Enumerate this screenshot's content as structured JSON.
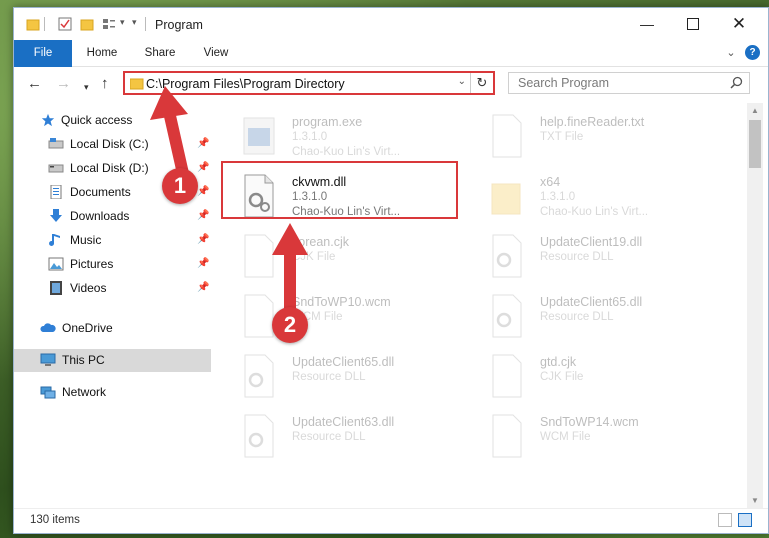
{
  "window": {
    "title": "Program",
    "controls": [
      "minimize",
      "maximize",
      "close"
    ]
  },
  "ribbon": {
    "tabs": [
      "File",
      "Home",
      "Share",
      "View"
    ]
  },
  "nav": {
    "address": "C:\\Program Files\\Program Directory",
    "search_placeholder": "Search Program"
  },
  "sidebar": {
    "items": [
      {
        "label": "Quick access",
        "icon": "star-icon"
      },
      {
        "label": "Local Disk (C:)",
        "icon": "drive-icon",
        "pinned": true
      },
      {
        "label": "Local Disk (D:)",
        "icon": "drive-icon",
        "pinned": true
      },
      {
        "label": "Documents",
        "icon": "documents-icon",
        "pinned": true
      },
      {
        "label": "Downloads",
        "icon": "download-icon",
        "pinned": true
      },
      {
        "label": "Music",
        "icon": "music-icon",
        "pinned": true
      },
      {
        "label": "Pictures",
        "icon": "pictures-icon",
        "pinned": true
      },
      {
        "label": "Videos",
        "icon": "videos-icon",
        "pinned": true
      },
      {
        "label": "OneDrive",
        "icon": "cloud-icon"
      },
      {
        "label": "This PC",
        "icon": "computer-icon",
        "selected": true
      },
      {
        "label": "Network",
        "icon": "network-icon"
      }
    ]
  },
  "files": {
    "left": [
      {
        "name": "program.exe",
        "line2": "1.3.1.0",
        "line3": "Chao-Kuo Lin's Virt...",
        "faded": true,
        "icon": "exe-icon"
      },
      {
        "name": "ckvwm.dll",
        "line2": "1.3.1.0",
        "line3": "Chao-Kuo Lin's Virt...",
        "faded": false,
        "icon": "dll-icon"
      },
      {
        "name": "korean.cjk",
        "line2": "CJK File",
        "faded": true,
        "icon": "file-icon"
      },
      {
        "name": "SndToWP10.wcm",
        "line2": "WCM File",
        "faded": true,
        "icon": "file-icon"
      },
      {
        "name": "UpdateClient65.dll",
        "line2": "Resource DLL",
        "faded": true,
        "icon": "dll-icon"
      },
      {
        "name": "UpdateClient63.dll",
        "line2": "Resource DLL",
        "faded": true,
        "icon": "dll-icon"
      }
    ],
    "right": [
      {
        "name": "help.fineReader.txt",
        "line2": "TXT File",
        "faded": true,
        "icon": "file-icon"
      },
      {
        "name": "x64",
        "line2": "1.3.1.0",
        "line3": "Chao-Kuo Lin's Virt...",
        "faded": true,
        "icon": "folder-icon"
      },
      {
        "name": "UpdateClient19.dll",
        "line2": "Resource DLL",
        "faded": true,
        "icon": "dll-icon"
      },
      {
        "name": "UpdateClient65.dll",
        "line2": "Resource DLL",
        "faded": true,
        "icon": "dll-icon"
      },
      {
        "name": "gtd.cjk",
        "line2": "CJK File",
        "faded": true,
        "icon": "file-icon"
      },
      {
        "name": "SndToWP14.wcm",
        "line2": "WCM File",
        "faded": true,
        "icon": "file-icon"
      }
    ]
  },
  "status": {
    "item_count": "130 items"
  },
  "markers": [
    "1",
    "2"
  ],
  "colors": {
    "accent": "#1a6fc4",
    "highlight": "#d9383a"
  }
}
